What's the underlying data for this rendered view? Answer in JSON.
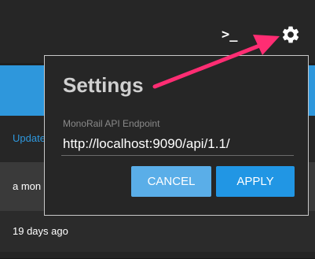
{
  "header": {
    "terminal_glyph": ">_"
  },
  "list": {
    "row1": "Update",
    "row2": "a mon",
    "row3": "19 days ago"
  },
  "settings_dialog": {
    "title": "Settings",
    "endpoint_label": "MonoRail API Endpoint",
    "endpoint_value": "http://localhost:9090/api/1.1/",
    "cancel_label": "CANCEL",
    "apply_label": "APPLY"
  },
  "annotation": {
    "arrow_color": "#ff2d73"
  },
  "colors": {
    "accent": "#2196e4",
    "cancel": "#5aaee8",
    "background": "#1f1f1f"
  }
}
